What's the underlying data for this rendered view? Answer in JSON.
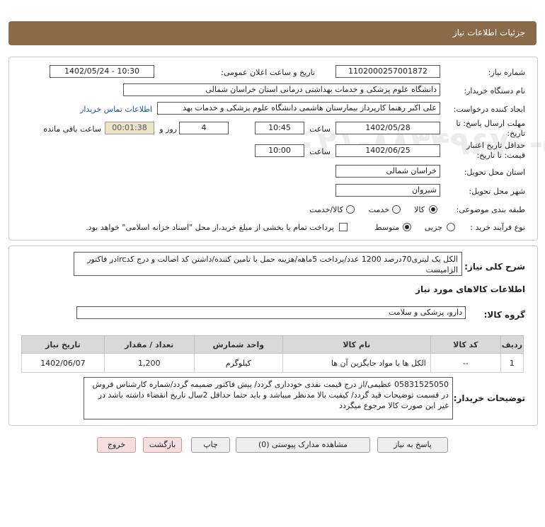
{
  "header": {
    "title": "جزئیات اطلاعات نیاز"
  },
  "fields": {
    "need_number_label": "شماره نیاز:",
    "need_number": "1102000257001872",
    "announce_label": "تاریخ و ساعت اعلان عمومی:",
    "announce_value": "1402/05/24 - 10:30",
    "buyer_label": "نام دستگاه خریدار:",
    "buyer_value": "دانشگاه علوم پزشکی و خدمات بهداشتی درمانی استان خراسان شمالی",
    "requester_label": "ایجاد کننده درخواست:",
    "requester_value": "علی اکبر رهنما کارپرداز بیمارستان هاشمی دانشگاه علوم پزشکی و خدمات بهد",
    "contact_link": "اطلاعات تماس خریدار",
    "deadline_label": "مهلت ارسال پاسخ: تا تاریخ:",
    "deadline_date": "1402/05/28",
    "time_label": "ساعت",
    "deadline_time": "10:45",
    "days_value": "4",
    "days_label": "روز و",
    "remaining_time": "00:01:38",
    "remaining_label": "ساعت باقی مانده",
    "validity_label": "حداقل تاریخ اعتبار قیمت: تا تاریخ:",
    "validity_date": "1402/06/25",
    "validity_time_label": "ساعت",
    "validity_time": "10:00",
    "province_label": "استان محل تحویل:",
    "province_value": "خراسان شمالی",
    "city_label": "شهر محل تحویل:",
    "city_value": "شیروان",
    "category_label": "طبقه بندی موضوعی:",
    "category_options": [
      "کالا",
      "خدمت",
      "کالا/خدمت"
    ],
    "category_selected": "کالا",
    "process_label": "نوع فرآیند خرید :",
    "process_options": [
      "جزیی",
      "متوسط"
    ],
    "process_selected": "متوسط",
    "treasury_text": "پرداخت تمام یا بخشی از مبلغ خرید،از محل \"اسناد خزانه اسلامی\" خواهد بود."
  },
  "description": {
    "label": "شرح کلی نیاز:",
    "text": "الکل یک لیتری70درصد 1200 عدد/پرداخت 5ماهه/هزینه حمل با تامین کننده/داشتن کد اصالت و درج کدircدر فاکتور الزامیست"
  },
  "goods_section": {
    "title": "اطلاعات کالاهای مورد نیاز",
    "group_label": "گروه کالا:",
    "group_value": "دارو، پزشکی و سلامت"
  },
  "table": {
    "headers": [
      "ردیف",
      "کد کالا",
      "نام کالا",
      "واحد شمارش",
      "تعداد / مقدار",
      "تاریخ نیاز"
    ],
    "rows": [
      [
        "1",
        "--",
        "الکل ها یا مواد جایگزین آن ها",
        "کیلوگرم",
        "1,200",
        "1402/06/07"
      ]
    ]
  },
  "buyer_notes": {
    "label": "توضیحات خریدار:",
    "text": "05831525050 عظیمی/از درج قیمت نقدی خودداری گردد/ پیش فاکتور ضمیمه گردد/شماره کارشناس فروش در قسمت توضیحات قید گردد/ کیفیت بالا مدنظر میباشد و باید حتما حداقل 2سال تاریخ انقضاء داشته باشد  در غیر این صورت کالا مرجوع میگردد"
  },
  "buttons": {
    "reply": "پاسخ به نیاز",
    "attachments": "مشاهده مدارک پیوستی (0)",
    "print": "چاپ",
    "back": "بازگشت",
    "exit": "خروج"
  },
  "watermark": {
    "brand": "ParsNamadData",
    "slogan1": "پایگاه اطلاع رسانی مناقصات و مزایدات",
    "slogan2": "فراوری اطلاعات پارس نماد داده",
    "phone": "۰۲۱-۸۸۳۴۹۶۷۰-۵"
  },
  "colors": {
    "header": "#8a6a48",
    "link": "#1a4fc0",
    "table_header": "#d9d9d9"
  }
}
